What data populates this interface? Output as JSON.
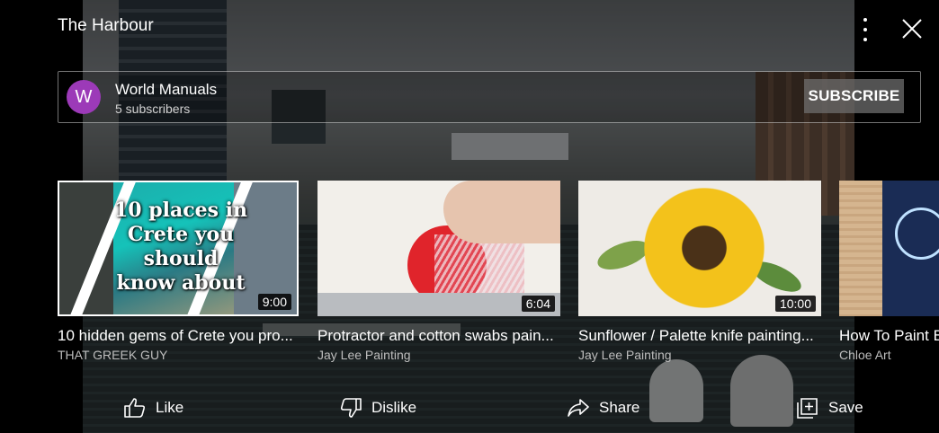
{
  "header": {
    "title": "The Harbour"
  },
  "channel": {
    "avatar_letter": "W",
    "name": "World Manuals",
    "subscribers": "5 subscribers",
    "subscribe_label": "SUBSCRIBE",
    "avatar_color": "#9c3ab8"
  },
  "videos": [
    {
      "title": "10 hidden gems of Crete you pro...",
      "author": "THAT GREEK GUY",
      "duration": "9:00",
      "thumb_text": [
        "10 places in",
        "Crete you",
        "should",
        "know about"
      ]
    },
    {
      "title": "Protractor and cotton swabs pain...",
      "author": "Jay Lee Painting",
      "duration": "6:04"
    },
    {
      "title": "Sunflower / Palette knife painting...",
      "author": "Jay Lee Painting",
      "duration": "10:00"
    },
    {
      "title": "How To Paint B",
      "author": "Chloe Art"
    }
  ],
  "actions": {
    "like": "Like",
    "dislike": "Dislike",
    "share": "Share",
    "save": "Save"
  },
  "icons": [
    "more-vert-icon",
    "close-icon",
    "thumbs-up-icon",
    "thumbs-down-icon",
    "share-arrow-icon",
    "add-to-playlist-icon"
  ]
}
